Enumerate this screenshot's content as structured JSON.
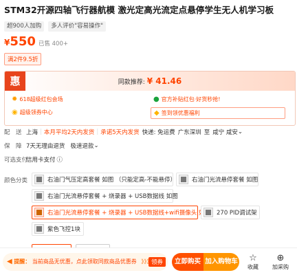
{
  "product": {
    "title": "STM32开源四轴飞行器航模 激光定高光流定点悬停学生无人机学习板",
    "tags": [
      "超900人加购",
      "多人评价\"容易操作\""
    ],
    "price_currency": "¥",
    "price": "550",
    "sold": "已售 400+",
    "coupon": "满2件9.5折"
  },
  "promo": {
    "hui_label": "惠",
    "same_price_label": "同款推荐:",
    "same_price": "¥ 41.46",
    "items": [
      {
        "icon": "sun-icon",
        "text": "618超级红包会场"
      },
      {
        "icon": "leaf-icon",
        "text": "官方补贴红包·好货秒抢!"
      },
      {
        "icon": "coin-icon",
        "text": "超级领券中心"
      },
      {
        "icon": "sign-in-icon",
        "text": "签到领优惠福利"
      }
    ]
  },
  "delivery": {
    "label": "配　送",
    "from": "上海",
    "avg": "本月平均2天内发货",
    "promise": "承诺5天内发货",
    "express": "快递: 免运费",
    "route_from": "广东深圳",
    "to_word": "至",
    "route_to": "咸宁 咸安"
  },
  "guarantee": {
    "label": "保　障",
    "items": [
      "7天无理由退货",
      "极速退款"
    ]
  },
  "payment": {
    "label": "可选支付",
    "value": "信用卡支付"
  },
  "variants": {
    "label": "颜色分类",
    "options": [
      {
        "text": "右油门气压定高套餐 如图 （只能定高-不能悬停）",
        "selected": false
      },
      {
        "text": "右油门光流悬停套餐 如图",
        "selected": false
      },
      {
        "text": "右油门光流悬停套餐 + 烧录器 + USB数据线 如图",
        "selected": false
      },
      {
        "text": "右油门光流悬停套餐 + 烧录器 + USB数据线+wifi摄像头 如图",
        "selected": true
      },
      {
        "text": "270 PID调试架",
        "selected": false
      },
      {
        "text": "紫色飞控1块",
        "selected": false
      }
    ]
  },
  "bottom_bar": {
    "tip_lead": "提醒：",
    "tip_text": "当前商品无优惠，点此领取同款商品优惠券",
    "tip_more": "》》》",
    "coupon_btn": "领券",
    "buy_now": "立即购买",
    "add_cart": "加入购物车",
    "favorite": "收藏",
    "add_buy": "加采购"
  },
  "colors": {
    "accent": "#ff4400",
    "cart": "#ff9500",
    "buy": "#ff5000"
  }
}
